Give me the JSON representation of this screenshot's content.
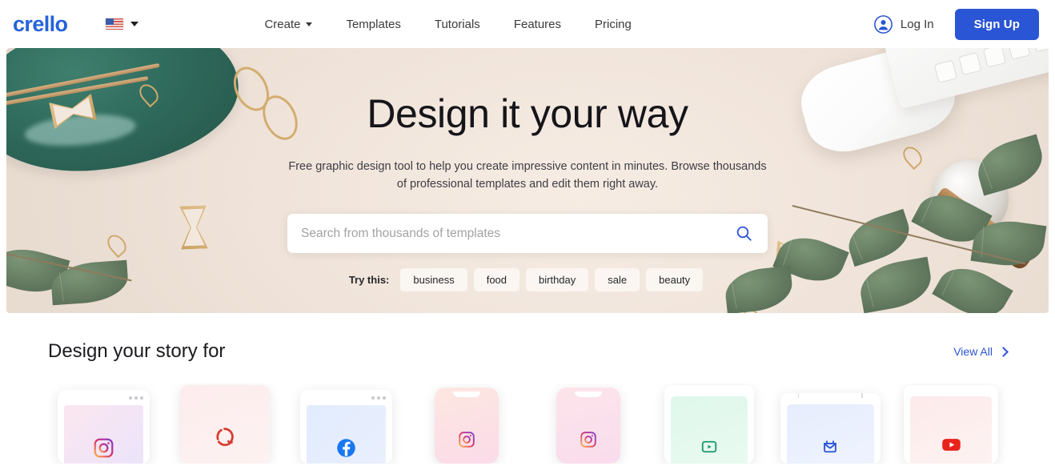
{
  "brand": {
    "logo": "crello",
    "accent": "#2a55d4"
  },
  "header": {
    "language": {
      "flag": "us-flag-icon",
      "caret": "chevron-down-icon"
    },
    "nav": [
      {
        "label": "Create",
        "has_dropdown": true
      },
      {
        "label": "Templates",
        "has_dropdown": false
      },
      {
        "label": "Tutorials",
        "has_dropdown": false
      },
      {
        "label": "Features",
        "has_dropdown": false
      },
      {
        "label": "Pricing",
        "has_dropdown": false
      }
    ],
    "login_label": "Log In",
    "login_icon": "user-circle-icon",
    "signup_label": "Sign Up"
  },
  "hero": {
    "title": "Design it your way",
    "subtitle": "Free graphic design tool to help you create impressive content in minutes. Browse thousands of professional templates and edit them right away.",
    "search": {
      "placeholder": "Search from thousands of templates",
      "value": "",
      "icon": "search-icon"
    },
    "try_label": "Try this:",
    "tags": [
      "business",
      "food",
      "birthday",
      "sale",
      "beauty"
    ]
  },
  "section": {
    "title": "Design your story for",
    "view_all_label": "View All",
    "view_all_icon": "chevron-right-icon"
  },
  "cards": [
    {
      "kind": "browser",
      "icon": "instagram-icon",
      "bg1": "#fbe6ef",
      "bg2": "#ece4fb"
    },
    {
      "kind": "square",
      "icon": "pinterest-icon",
      "bg1": "#fdeced",
      "bg2": "#fdf2f1"
    },
    {
      "kind": "browser",
      "icon": "facebook-icon",
      "bg1": "#e2ecfd",
      "bg2": "#e9effd"
    },
    {
      "kind": "phone",
      "icon": "instagram-icon",
      "bg1": "#fde7e0",
      "bg2": "#fbdbe9"
    },
    {
      "kind": "phone",
      "icon": "instagram-icon",
      "bg1": "#fce4ea",
      "bg2": "#f9dced"
    },
    {
      "kind": "square",
      "icon": "video-play-icon",
      "bg1": "#dff7ea",
      "bg2": "#e9faf1"
    },
    {
      "kind": "tablet",
      "icon": "vk-mail-icon",
      "bg1": "#e7edfd",
      "bg2": "#eff3fe"
    },
    {
      "kind": "square",
      "icon": "youtube-icon",
      "bg1": "#fdeaea",
      "bg2": "#fdf3f2"
    }
  ]
}
